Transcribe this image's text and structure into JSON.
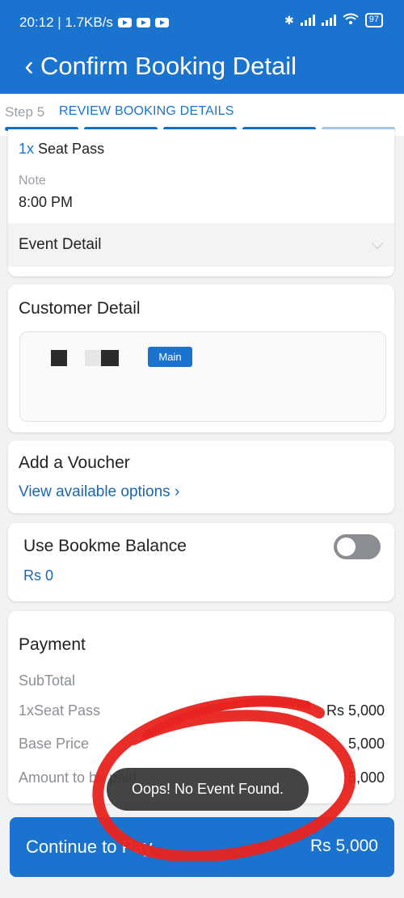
{
  "status_bar": {
    "time_speed": "20:12 | 1.7KB/s",
    "battery": "97"
  },
  "header": {
    "title": "Confirm Booking Detail"
  },
  "stepper": {
    "step": "Step 5",
    "name": "REVIEW BOOKING DETAILS"
  },
  "booking": {
    "seat_qty": "1x",
    "seat_name": "Seat Pass",
    "note_label": "Note",
    "note_value": "8:00 PM",
    "event_detail_label": "Event Detail"
  },
  "customer": {
    "title": "Customer Detail",
    "badge": "Main"
  },
  "voucher": {
    "title": "Add a Voucher",
    "link": "View available options ›"
  },
  "balance": {
    "title": "Use Bookme Balance",
    "amount": "Rs 0",
    "enabled": false
  },
  "payment": {
    "title": "Payment",
    "subtotal_label": "SubTotal",
    "rows": [
      {
        "label": "1xSeat Pass",
        "value": "Rs 5,000"
      },
      {
        "label": "Base Price",
        "value": "5,000"
      },
      {
        "label": "Amount to be paid",
        "value": "5,000"
      }
    ]
  },
  "footer": {
    "continue_label": "Continue to Pay",
    "total": "Rs 5,000"
  },
  "toast": {
    "message": "Oops! No Event Found."
  },
  "colors": {
    "primary": "#1a73cf",
    "annotation": "#e8231f"
  }
}
